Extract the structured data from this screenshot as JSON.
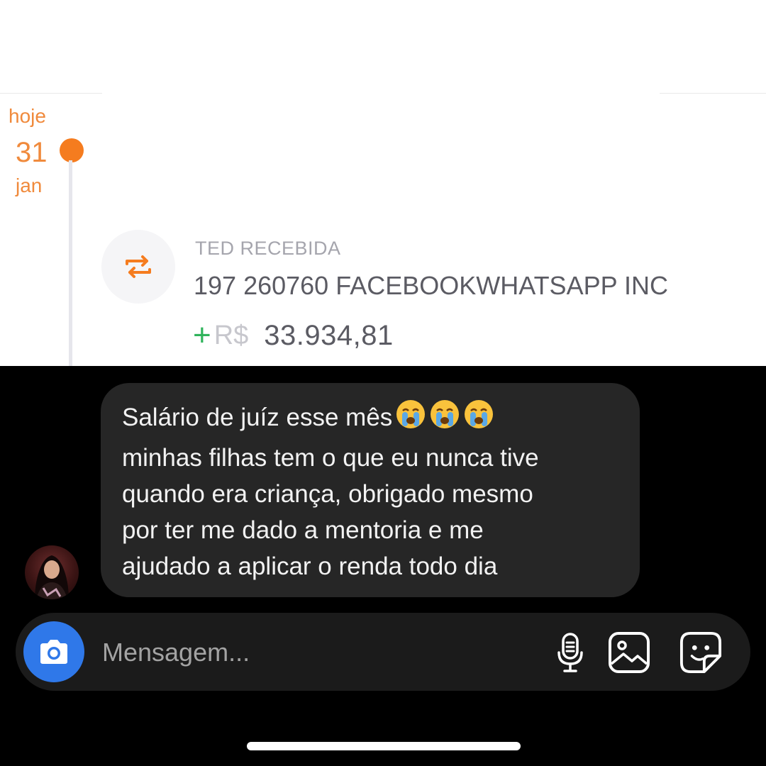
{
  "statement": {
    "date_label": "hoje",
    "day": "31",
    "month": "jan",
    "transaction": {
      "type": "TED RECEBIDA",
      "description": "197 260760 FACEBOOKWHATSAPP INC",
      "sign": "+",
      "currency": "R$",
      "amount": "33.934,81"
    },
    "colors": {
      "accent": "#f57c1f",
      "positive": "#2fb35b"
    }
  },
  "chat": {
    "message": {
      "first_line": "Salário de juíz esse mês",
      "emojis": [
        "loudly-crying-face-icon",
        "loudly-crying-face-icon",
        "loudly-crying-face-icon"
      ],
      "body": "minhas filhas tem o que eu nunca tive\nquando era criança, obrigado mesmo\npor ter me dado a mentoria e me\najudado a aplicar o renda todo dia"
    },
    "composer": {
      "placeholder": "Mensagem...",
      "icons": [
        "camera-icon",
        "microphone-icon",
        "gallery-icon",
        "sticker-icon"
      ]
    },
    "colors": {
      "camera_button": "#2f78e9",
      "bubble": "#262626"
    }
  }
}
